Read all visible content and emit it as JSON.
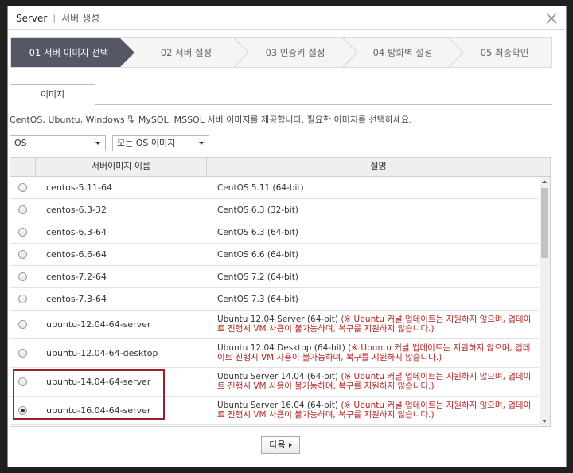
{
  "window": {
    "title": "Server",
    "subtitle": "서버 생성"
  },
  "steps": [
    {
      "label": "01 서버 이미지 선택",
      "active": true
    },
    {
      "label": "02 서버 설정",
      "active": false
    },
    {
      "label": "03 인증키 설정",
      "active": false
    },
    {
      "label": "04 방화벽 설정",
      "active": false
    },
    {
      "label": "05 최종확인",
      "active": false
    }
  ],
  "tabs": [
    {
      "label": "이미지"
    }
  ],
  "description": "CentOS, Ubuntu, Windows 및 MySQL, MSSQL 서버 이미지를 제공합니다. 필요한 이미지를 선택하세요.",
  "filters": {
    "os": "OS",
    "image": "모든 OS 이미지"
  },
  "table": {
    "headers": [
      "서버이미지 이름",
      "설명"
    ],
    "rows": [
      {
        "name": "centos-5.11-64",
        "desc": "CentOS 5.11 (64-bit)",
        "warn": "",
        "checked": false
      },
      {
        "name": "centos-6.3-32",
        "desc": "CentOS 6.3 (32-bit)",
        "warn": "",
        "checked": false
      },
      {
        "name": "centos-6.3-64",
        "desc": "CentOS 6.3 (64-bit)",
        "warn": "",
        "checked": false
      },
      {
        "name": "centos-6.6-64",
        "desc": "CentOS 6.6 (64-bit)",
        "warn": "",
        "checked": false
      },
      {
        "name": "centos-7.2-64",
        "desc": "CentOS 7.2 (64-bit)",
        "warn": "",
        "checked": false
      },
      {
        "name": "centos-7.3-64",
        "desc": "CentOS 7.3 (64-bit)",
        "warn": "",
        "checked": false
      },
      {
        "name": "ubuntu-12.04-64-server",
        "desc": "Ubuntu 12.04 Server (64-bit)",
        "warn": "(※ Ubuntu 커널 업데이트는 지원하지 않으며, 업데이트 진행시 VM 사용이 불가능하며, 복구를 지원하지 않습니다.)",
        "checked": false
      },
      {
        "name": "ubuntu-12.04-64-desktop",
        "desc": "Ubuntu 12.04 Desktop (64-bit)",
        "warn": "(※ Ubuntu 커널 업데이트는 지원하지 않으며, 업데이트 진행시 VM 사용이 불가능하며, 복구를 지원하지 않습니다.)",
        "checked": false
      },
      {
        "name": "ubuntu-14.04-64-server",
        "desc": "Ubuntu Server 14.04 (64-bit)",
        "warn": "(※ Ubuntu 커널 업데이트는 지원하지 않으며, 업데이트 진행시 VM 사용이 불가능하며, 복구를 지원하지 않습니다.)",
        "checked": false
      },
      {
        "name": "ubuntu-16.04-64-server",
        "desc": "Ubuntu Server 16.04 (64-bit)",
        "warn": "(※ Ubuntu 커널 업데이트는 지원하지 않으며, 업데이트 진행시 VM 사용이 불가능하며, 복구를 지원하지 않습니다.)",
        "checked": true
      }
    ]
  },
  "buttons": {
    "next": "다음"
  },
  "colors": {
    "active_step": "#545866",
    "warning_text": "#b3231f",
    "highlight_border": "#9e1f28"
  }
}
